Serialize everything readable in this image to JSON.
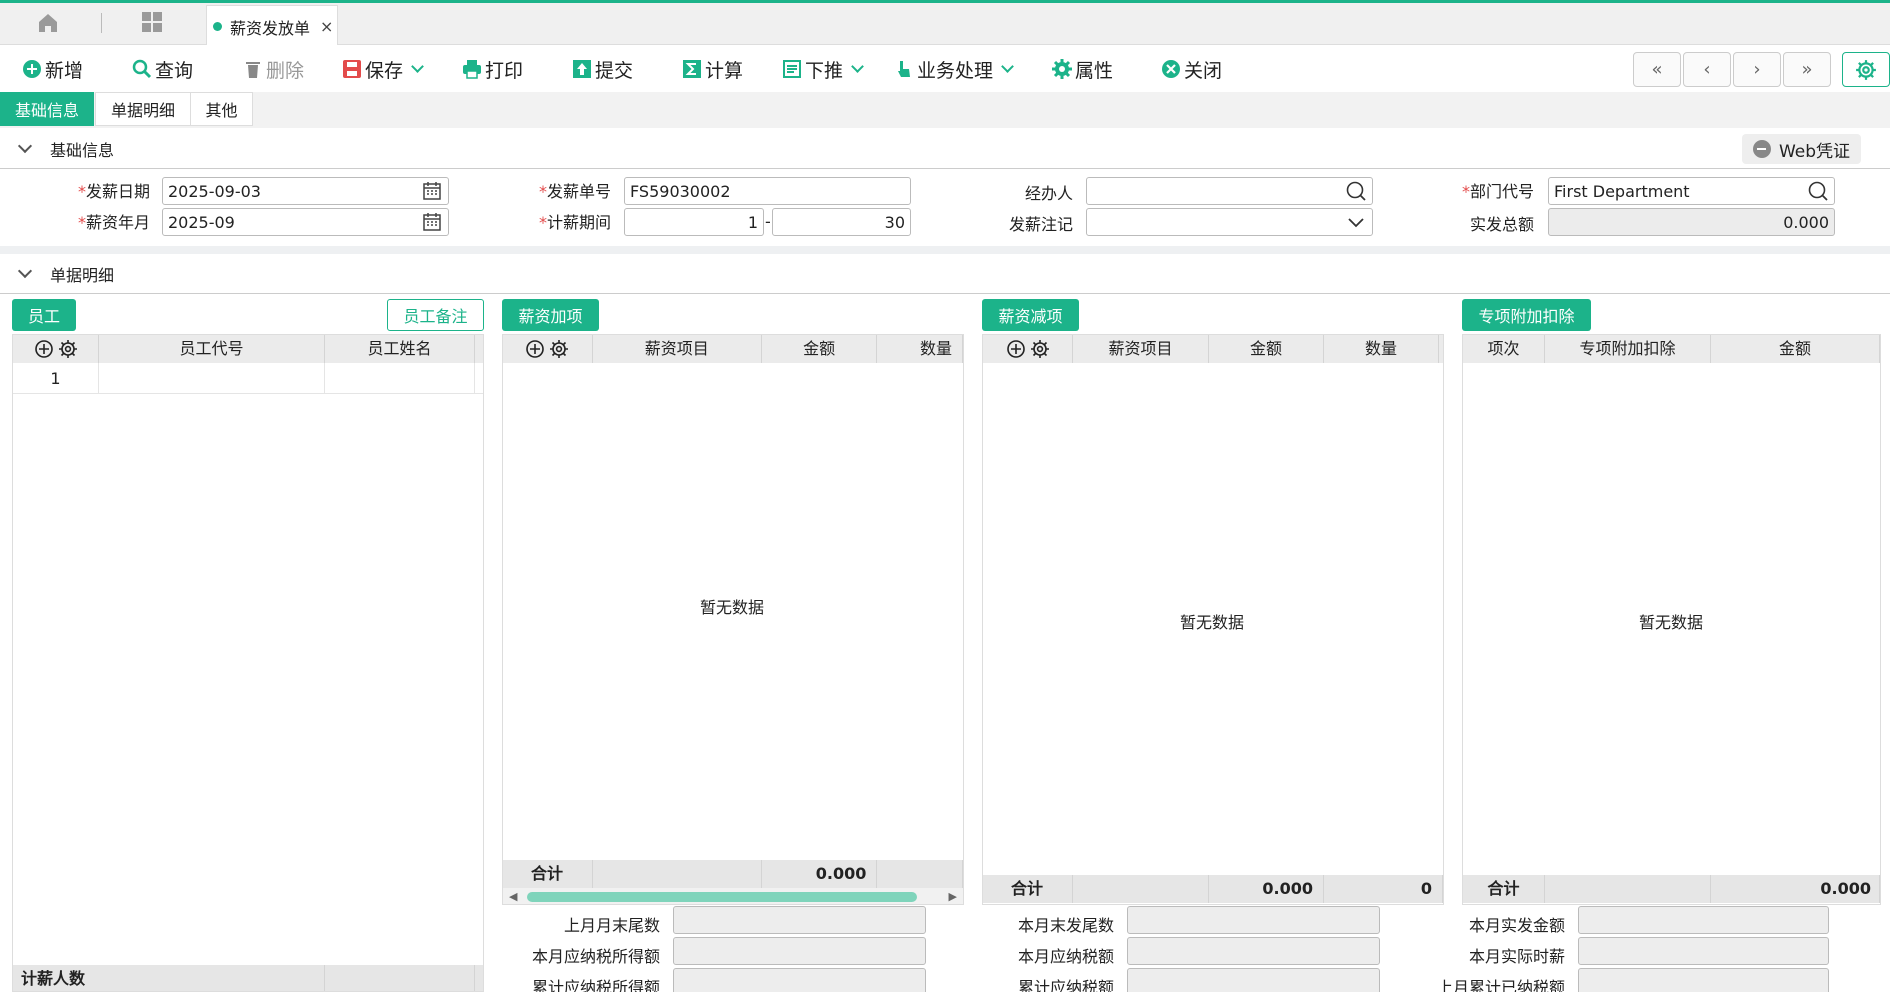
{
  "tabs": {
    "active_label": "薪资发放单",
    "close": "×"
  },
  "toolbar": {
    "new": "新增",
    "query": "查询",
    "delete": "删除",
    "save": "保存",
    "print": "打印",
    "submit": "提交",
    "calculate": "计算",
    "push_down": "下推",
    "business": "业务处理",
    "properties": "属性",
    "close": "关闭"
  },
  "subtabs": [
    "基础信息",
    "单据明细",
    "其他"
  ],
  "section_basic": {
    "title": "基础信息",
    "web_voucher": "Web凭证"
  },
  "form": {
    "pay_date": {
      "label": "发薪日期",
      "value": "2025-09-03"
    },
    "pay_month": {
      "label": "薪资年月",
      "value": "2025-09"
    },
    "bill_no": {
      "label": "发薪单号",
      "value": "FS59030002"
    },
    "period": {
      "label": "计薪期间",
      "from": "1",
      "sep": "-",
      "to": "30"
    },
    "handler": {
      "label": "经办人",
      "value": ""
    },
    "remark": {
      "label": "发薪注记",
      "value": ""
    },
    "dept": {
      "label": "部门代号",
      "value": "First Department"
    },
    "total": {
      "label": "实发总额",
      "value": "0.000"
    }
  },
  "section_detail": {
    "title": "单据明细"
  },
  "employees": {
    "title": "员工",
    "note_button": "员工备注",
    "columns": [
      "员工代号",
      "员工姓名"
    ],
    "rows": [
      {
        "index": "1",
        "code": "",
        "name": ""
      }
    ],
    "footer_label": "计薪人数"
  },
  "additions": {
    "title": "薪资加项",
    "columns": [
      "薪资项目",
      "金额",
      "数量"
    ],
    "empty": "暂无数据",
    "sum_label": "合计",
    "sum_amount": "0.000"
  },
  "deductions": {
    "title": "薪资减项",
    "columns": [
      "薪资项目",
      "金额",
      "数量"
    ],
    "empty": "暂无数据",
    "sum_label": "合计",
    "sum_amount": "0.000",
    "sum_qty": "0"
  },
  "special": {
    "title": "专项附加扣除",
    "columns": [
      "项次",
      "专项附加扣除",
      "金额"
    ],
    "empty": "暂无数据",
    "sum_label": "合计",
    "sum_amount": "0.000"
  },
  "bottom_fields": {
    "col1": [
      "上月月末尾数",
      "本月应纳税所得额",
      "累计应纳税所得额"
    ],
    "col2": [
      "本月末发尾数",
      "本月应纳税额",
      "累计应纳税额"
    ],
    "col3": [
      "本月实发金额",
      "本月实际时薪",
      "上月累计已纳税额"
    ]
  },
  "colors": {
    "accent": "#1cb38a",
    "required": "#e34b4b"
  }
}
